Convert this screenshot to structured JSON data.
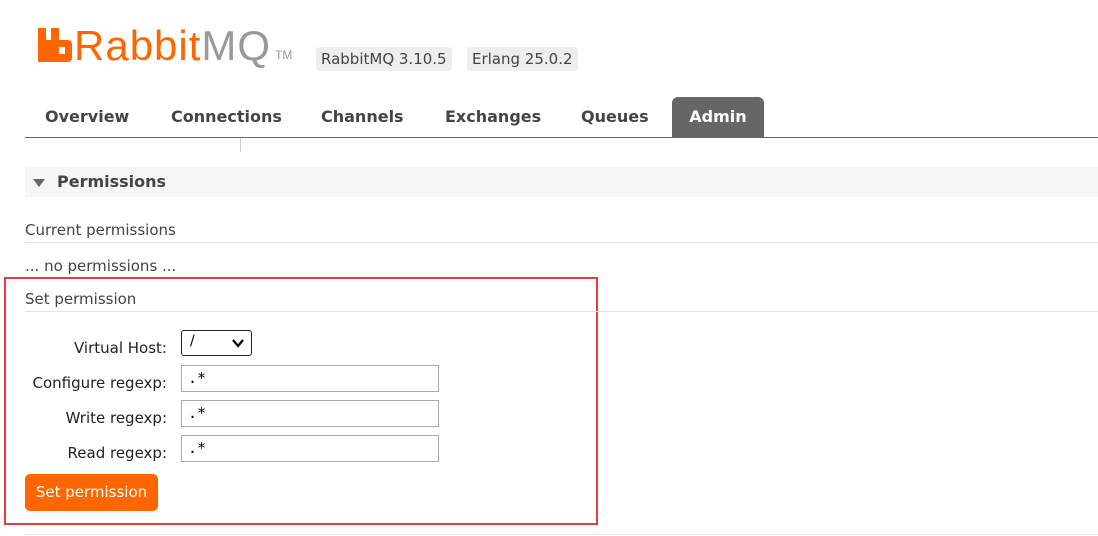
{
  "header": {
    "logo_rabbit": "Rabbit",
    "logo_mq": "MQ",
    "logo_tm": "TM",
    "rabbitmq_version": "RabbitMQ 3.10.5",
    "erlang_version": "Erlang 25.0.2"
  },
  "tabs": [
    {
      "label": "Overview"
    },
    {
      "label": "Connections"
    },
    {
      "label": "Channels"
    },
    {
      "label": "Exchanges"
    },
    {
      "label": "Queues"
    },
    {
      "label": "Admin"
    }
  ],
  "active_tab": "Admin",
  "permissions": {
    "section_title": "Permissions",
    "current_title": "Current permissions",
    "current_empty": "... no permissions ...",
    "set_title": "Set permission",
    "virtual_host_label": "Virtual Host:",
    "virtual_host_value": "/",
    "configure_label": "Configure regexp:",
    "configure_value": ".*",
    "write_label": "Write regexp:",
    "write_value": ".*",
    "read_label": "Read regexp:",
    "read_value": ".*",
    "submit_label": "Set permission"
  },
  "colors": {
    "accent": "#ff6600",
    "tab_active_bg": "#666666",
    "highlight_border": "#e63c3c"
  }
}
